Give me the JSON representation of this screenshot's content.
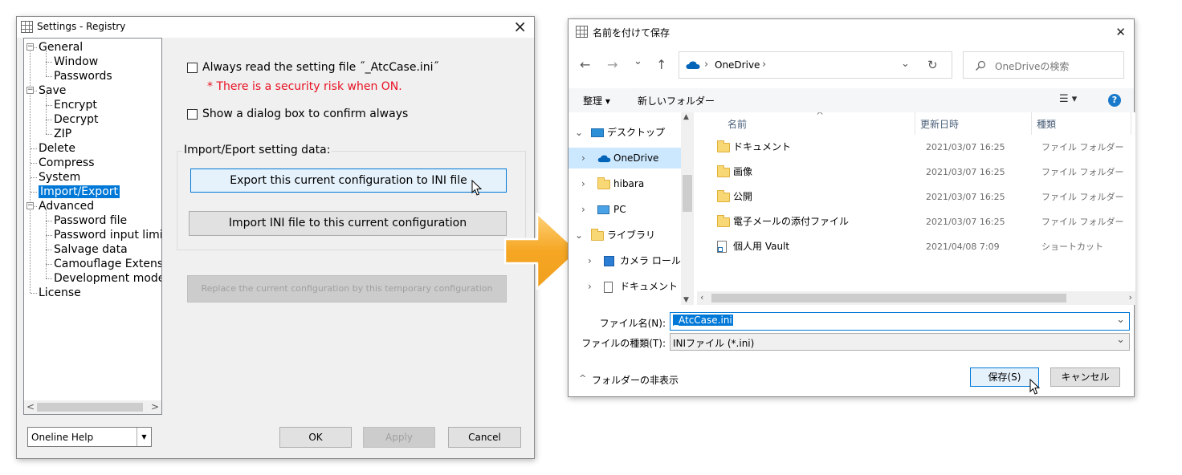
{
  "colors": {
    "accent": "#0078d7",
    "warning": "#e81123",
    "arrow": "#f5a623"
  },
  "settings": {
    "title": "Settings - Registry",
    "close_icon": "×",
    "tree": [
      {
        "label": "General",
        "level": 0,
        "expander": "−"
      },
      {
        "label": "Window",
        "level": 1
      },
      {
        "label": "Passwords",
        "level": 1
      },
      {
        "label": "Save",
        "level": 0,
        "expander": "−"
      },
      {
        "label": "Encrypt",
        "level": 1
      },
      {
        "label": "Decrypt",
        "level": 1
      },
      {
        "label": "ZIP",
        "level": 1
      },
      {
        "label": "Delete",
        "level": 0
      },
      {
        "label": "Compress",
        "level": 0
      },
      {
        "label": "System",
        "level": 0
      },
      {
        "label": "Import/Export",
        "level": 0,
        "selected": true
      },
      {
        "label": "Advanced",
        "level": 0,
        "expander": "−"
      },
      {
        "label": "Password file",
        "level": 1
      },
      {
        "label": "Password input limit",
        "level": 1
      },
      {
        "label": "Salvage data",
        "level": 1
      },
      {
        "label": "Camouflage Extension",
        "level": 1
      },
      {
        "label": "Development mode",
        "level": 1
      },
      {
        "label": "License",
        "level": 0
      }
    ],
    "scroll_left": "<",
    "scroll_right": ">",
    "opt_read_setting": "Always read the setting file ˝_AtcCase.ini˝",
    "opt_warning": "* There is a security risk when ON.",
    "opt_show_dialog": "Show a dialog box to confirm always",
    "group_label": "Import/Eport setting data:",
    "export_button": "Export this current configuration to INI file",
    "import_button": "Import INI file to this current configuration",
    "replace_button": "Replace the current configuration by this temporary configuration",
    "help_combo": "Oneline Help",
    "help_combo_arrow": "▼",
    "ok": "OK",
    "apply": "Apply",
    "cancel": "Cancel"
  },
  "save_dialog": {
    "title": "名前を付けて保存",
    "close_icon": "✕",
    "nav_back": "←",
    "nav_forward": "→",
    "nav_recent": "⌄",
    "nav_up": "↑",
    "address": "OneDrive",
    "address_sep": "›",
    "address_dropdown": "⌄",
    "refresh": "↻",
    "search_placeholder": "OneDriveの検索",
    "organize": "整理 ▾",
    "new_folder": "新しいフォルダー",
    "view_menu": "☰ ▾",
    "help": "?",
    "nav_items": [
      {
        "label": "デスクトップ",
        "chevron": "⌄",
        "icon": "desktop"
      },
      {
        "label": "OneDrive",
        "chevron": "›",
        "icon": "cloud",
        "selected": true
      },
      {
        "label": "hibara",
        "chevron": "›",
        "icon": "folder"
      },
      {
        "label": "PC",
        "chevron": "›",
        "icon": "pc"
      },
      {
        "label": "ライブラリ",
        "chevron": "⌄",
        "icon": "folder"
      },
      {
        "label": "カメラ ロール",
        "chevron": "›",
        "icon": "pictures"
      },
      {
        "label": "ドキュメント",
        "chevron": "›",
        "icon": "document"
      }
    ],
    "columns": {
      "name": "名前",
      "date": "更新日時",
      "type": "種類",
      "sort_indicator": "^"
    },
    "files": [
      {
        "name": "ドキュメント",
        "date": "2021/03/07 16:25",
        "type": "ファイル フォルダー",
        "icon": "folder"
      },
      {
        "name": "画像",
        "date": "2021/03/07 16:25",
        "type": "ファイル フォルダー",
        "icon": "folder"
      },
      {
        "name": "公開",
        "date": "2021/03/07 16:25",
        "type": "ファイル フォルダー",
        "icon": "folder"
      },
      {
        "name": "電子メールの添付ファイル",
        "date": "2021/03/07 16:25",
        "type": "ファイル フォルダー",
        "icon": "folder"
      },
      {
        "name": "個人用 Vault",
        "date": "2021/04/08 7:09",
        "type": "ショートカット",
        "icon": "shortcut"
      }
    ],
    "filename_label": "ファイル名(N):",
    "filename_value": "_AtcCase.ini",
    "filetype_label": "ファイルの種類(T):",
    "filetype_value": "INIファイル (*.ini)",
    "dropdown_arrow": "⌄",
    "hide_folders": "フォルダーの非表示",
    "hide_folders_icon": "^",
    "save": "保存(S)",
    "cancel": "キャンセル"
  }
}
